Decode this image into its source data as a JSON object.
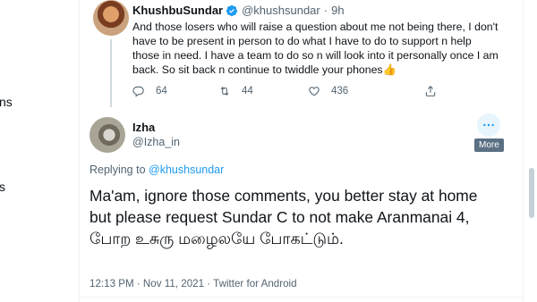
{
  "left_rail": {
    "fragments": [
      "ns",
      "s"
    ]
  },
  "parent_tweet": {
    "name": "KhushbuSundar",
    "handle": "@khushsundar",
    "separator": "·",
    "time": "9h",
    "text": "And those losers who will raise a question about me not being there, I don't have to be present in person to do what I have to do to support n help those in need. I have a team to do so n will look into it personally once I am back. So sit back n continue to twiddle your phones👍",
    "actions": {
      "replies": "64",
      "retweets": "44",
      "likes": "436"
    }
  },
  "reply_tweet": {
    "name": "Izha",
    "handle": "@Izha_in",
    "more_tooltip": "More",
    "replying_prefix": "Replying to",
    "replying_handle": "@khushsundar",
    "text": "Ma'am, ignore those comments, you better stay at home but please request Sundar C to not make Aranmanai 4, போற உசுரு மழைலயே போகட்டும்.",
    "meta": "12:13 PM · Nov 11, 2021 · Twitter for Android"
  },
  "colors": {
    "accent": "#1d9bf0",
    "secondary_text": "#536471",
    "primary_text": "#0f1419"
  },
  "icons": [
    "verified-badge-icon",
    "reply-icon",
    "retweet-icon",
    "like-icon",
    "share-icon",
    "more-icon"
  ]
}
